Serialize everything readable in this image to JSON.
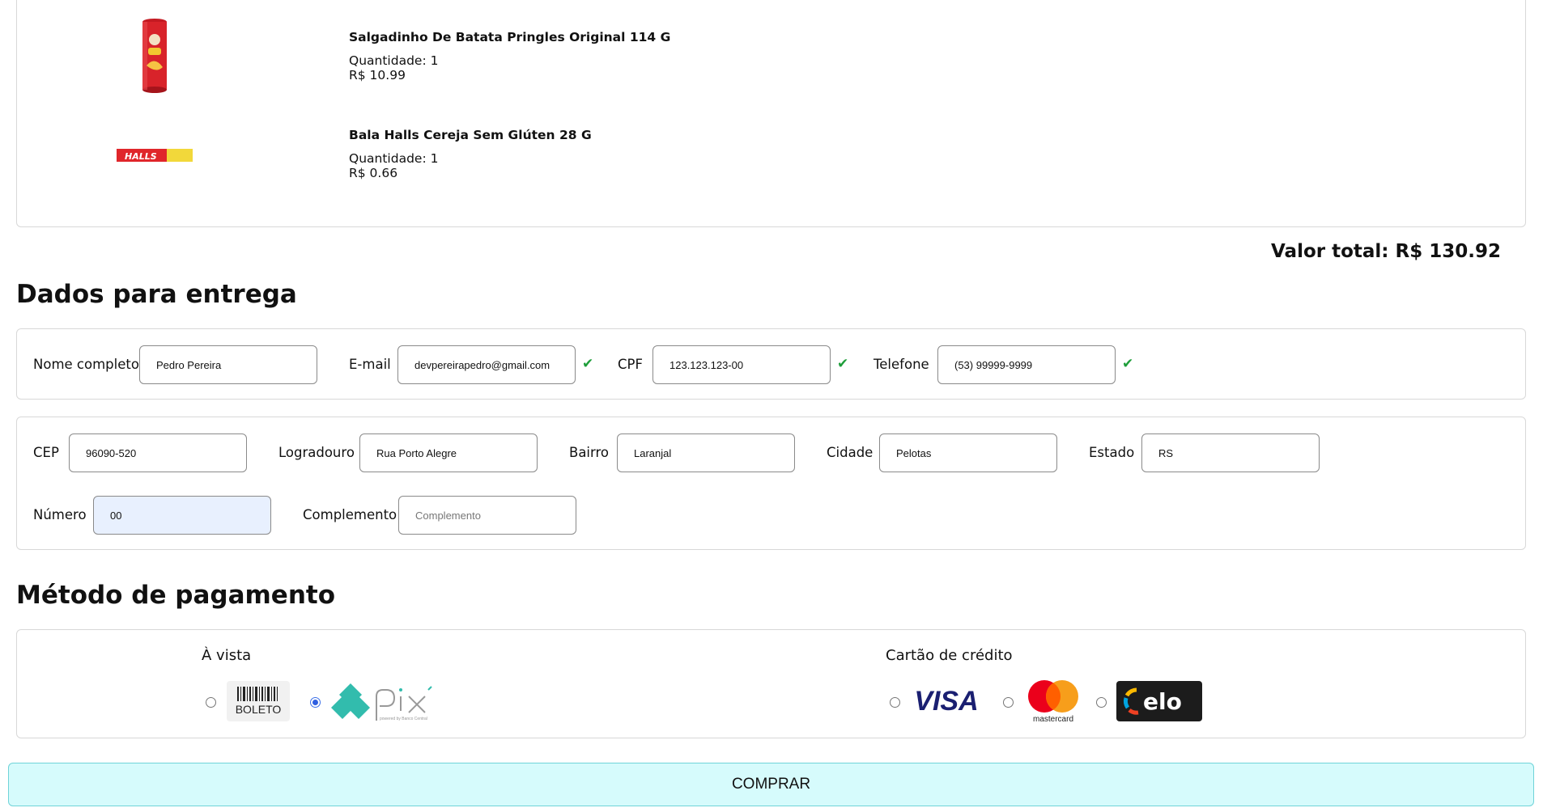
{
  "cart": {
    "items": [
      {
        "name": "Salgadinho De Batata Pringles Original 114 G",
        "quantity": "Quantidade: 1",
        "price": "R$ 10.99",
        "image": "pringles-can-icon"
      },
      {
        "name": "Bala Halls Cereja Sem Glúten 28 G",
        "quantity": "Quantidade: 1",
        "price": "R$ 0.66",
        "image": "halls-pack-icon"
      }
    ],
    "halls_logo_text": "HALLS"
  },
  "total": "Valor total: R$ 130.92",
  "delivery": {
    "title": "Dados para entrega",
    "name_label": "Nome completo",
    "name_value": "Pedro Pereira",
    "email_label": "E-mail",
    "email_value": "devpereirapedro@gmail.com",
    "cpf_label": "CPF",
    "cpf_value": "123.123.123-00",
    "phone_label": "Telefone",
    "phone_value": "(53) 99999-9999",
    "check": "✔",
    "cep_label": "CEP",
    "cep_value": "96090-520",
    "street_label": "Logradouro",
    "street_value": "Rua Porto Alegre",
    "district_label": "Bairro",
    "district_value": "Laranjal",
    "city_label": "Cidade",
    "city_value": "Pelotas",
    "state_label": "Estado",
    "state_value": "RS",
    "number_label": "Número",
    "number_value": "00",
    "complement_label": "Complemento",
    "complement_placeholder": "Complemento"
  },
  "payment": {
    "title": "Método de pagamento",
    "cash_label": "À vista",
    "credit_label": "Cartão de crédito",
    "selected": "pix",
    "boleto_text": "BOLETO",
    "visa_text": "VISA",
    "mastercard_text": "mastercard",
    "elo_text": "elo",
    "pix_tagline": "powered by Banco Central",
    "colors": {
      "pix": "#32bcad",
      "visa": "#1a1f71",
      "mc_red": "#eb001b",
      "mc_yellow": "#f79e1b",
      "elo_bg": "#1c1c1c"
    }
  },
  "buy_button": "COMPRAR"
}
